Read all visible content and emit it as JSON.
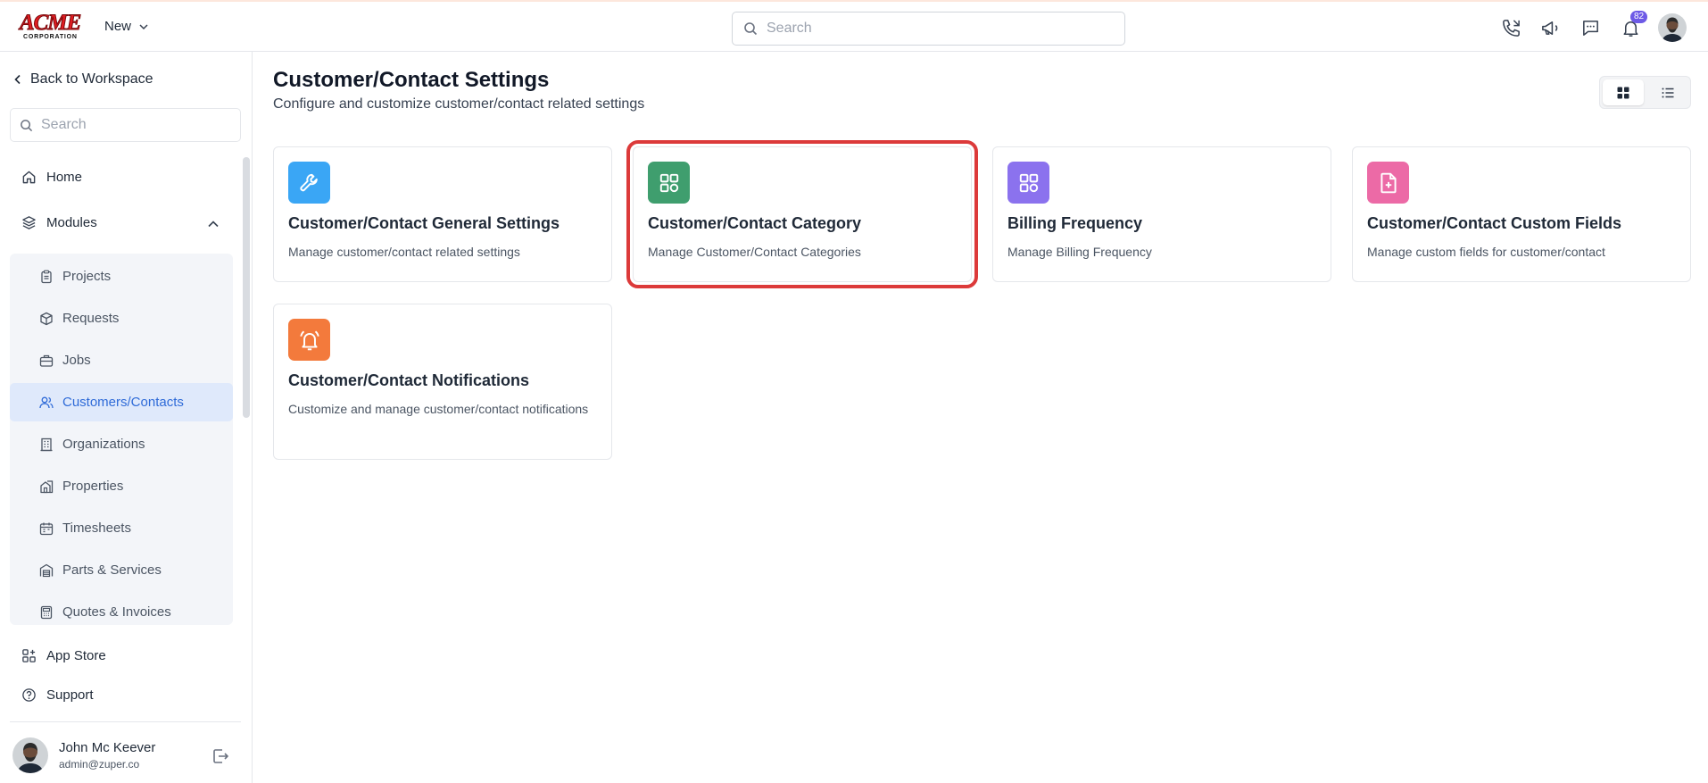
{
  "topbar": {
    "logo_text": "ACME",
    "logo_subtext": "CORPORATION",
    "new_label": "New",
    "search_placeholder": "Search",
    "notification_count": "82",
    "icons": [
      "phone-icon",
      "megaphone-icon",
      "chat-icon",
      "bell-icon"
    ]
  },
  "sidebar": {
    "back_label": "Back to Workspace",
    "search_placeholder": "Search",
    "home_label": "Home",
    "modules_label": "Modules",
    "module_items": [
      {
        "label": "Projects",
        "icon": "clipboard-icon"
      },
      {
        "label": "Requests",
        "icon": "box-icon"
      },
      {
        "label": "Jobs",
        "icon": "briefcase-icon"
      },
      {
        "label": "Customers/Contacts",
        "icon": "users-icon",
        "active": true
      },
      {
        "label": "Organizations",
        "icon": "building-icon"
      },
      {
        "label": "Properties",
        "icon": "property-icon"
      },
      {
        "label": "Timesheets",
        "icon": "calendar-icon"
      },
      {
        "label": "Parts & Services",
        "icon": "warehouse-icon"
      },
      {
        "label": "Quotes & Invoices",
        "icon": "calculator-icon"
      }
    ],
    "app_store_label": "App Store",
    "support_label": "Support",
    "user": {
      "name": "John Mc Keever",
      "email": "admin@zuper.co"
    }
  },
  "main": {
    "title": "Customer/Contact Settings",
    "subtitle": "Configure and customize customer/contact related settings",
    "view_mode": "grid",
    "cards": [
      {
        "title": "Customer/Contact General Settings",
        "description": "Manage customer/contact related settings",
        "icon": "wrench-icon",
        "color": "#3aa6f5"
      },
      {
        "title": "Customer/Contact Category",
        "description": "Manage Customer/Contact Categories",
        "icon": "category-grid-icon",
        "color": "#3f9e6e",
        "highlighted": true
      },
      {
        "title": "Billing Frequency",
        "description": "Manage Billing Frequency",
        "icon": "category-grid-icon",
        "color": "#8b72ee"
      },
      {
        "title": "Customer/Contact Custom Fields",
        "description": "Manage custom fields for customer/contact",
        "icon": "file-plus-icon",
        "color": "#ec6aa6"
      },
      {
        "title": "Customer/Contact Notifications",
        "description": "Customize and manage customer/contact notifications",
        "icon": "bell-ring-icon",
        "color": "#f37a3c"
      }
    ]
  },
  "colors": {
    "accent": "#2f6bd8",
    "active_bg": "#dfe9fb",
    "highlight": "#dc3a3a",
    "badge": "#6d5ae6"
  }
}
